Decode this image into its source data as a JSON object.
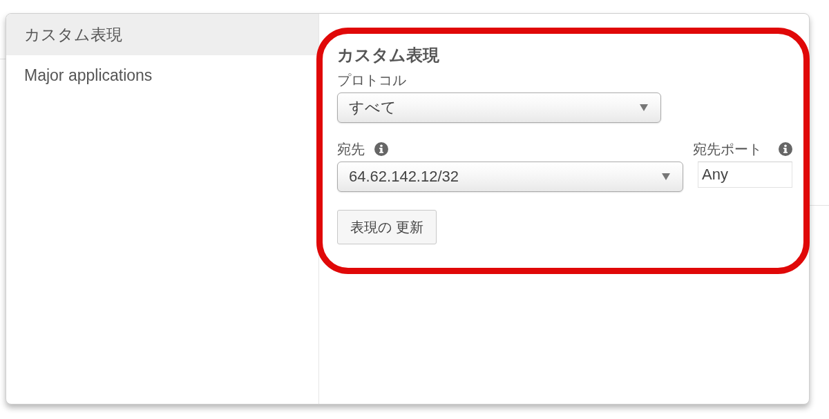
{
  "sidebar": {
    "items": [
      {
        "label": "カスタム表現",
        "selected": true
      },
      {
        "label": "Major applications",
        "selected": false
      }
    ]
  },
  "form": {
    "title": "カスタム表現",
    "rows": [
      {
        "fields": [
          {
            "kind": "select",
            "label": "プロトコル",
            "value": "すべて",
            "info": false
          }
        ]
      },
      {
        "fields": [
          {
            "kind": "select",
            "label": "宛先",
            "value": "64.62.142.12/32",
            "info": true
          },
          {
            "kind": "text",
            "label": "宛先ポート",
            "value": "Any",
            "info": true
          }
        ]
      }
    ],
    "button": "表現の 更新"
  },
  "annotation": {
    "kind": "rounded-outline"
  }
}
